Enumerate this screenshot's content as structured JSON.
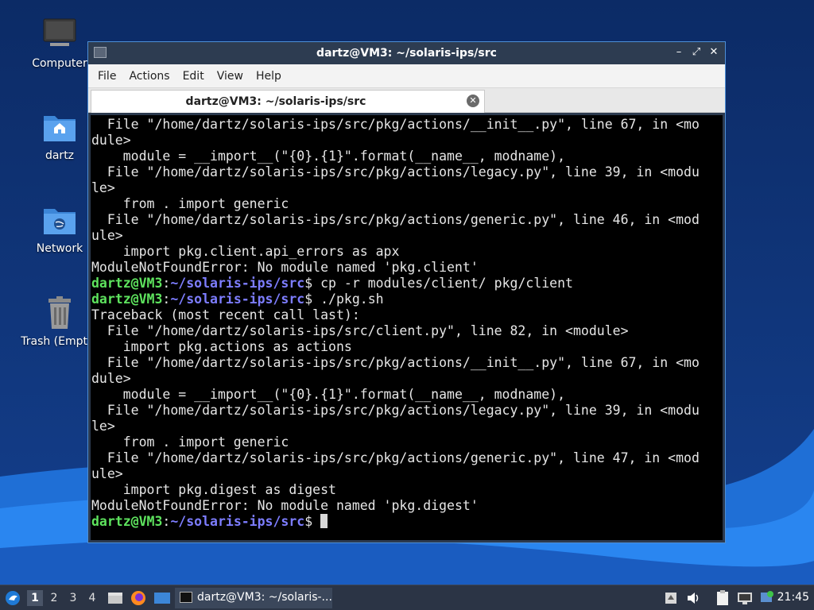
{
  "desktop": {
    "icons": [
      {
        "label": "Computer",
        "icon": "computer-icon"
      },
      {
        "label": "dartz",
        "icon": "home-folder-icon"
      },
      {
        "label": "Network",
        "icon": "network-folder-icon"
      },
      {
        "label": "Trash (Empty)",
        "icon": "trash-icon"
      }
    ]
  },
  "window": {
    "title": "dartz@VM3: ~/solaris-ips/src",
    "menu": [
      "File",
      "Actions",
      "Edit",
      "View",
      "Help"
    ],
    "tab": {
      "label": "dartz@VM3: ~/solaris-ips/src"
    },
    "terminal": {
      "prompt_user": "dartz@VM3",
      "prompt_path": "~/solaris-ips/src",
      "lines": [
        {
          "type": "out",
          "text": "  File \"/home/dartz/solaris-ips/src/pkg/actions/__init__.py\", line 67, in <mo"
        },
        {
          "type": "out",
          "text": "dule>"
        },
        {
          "type": "out",
          "text": "    module = __import__(\"{0}.{1}\".format(__name__, modname),"
        },
        {
          "type": "out",
          "text": "  File \"/home/dartz/solaris-ips/src/pkg/actions/legacy.py\", line 39, in <modu"
        },
        {
          "type": "out",
          "text": "le>"
        },
        {
          "type": "out",
          "text": "    from . import generic"
        },
        {
          "type": "out",
          "text": "  File \"/home/dartz/solaris-ips/src/pkg/actions/generic.py\", line 46, in <mod"
        },
        {
          "type": "out",
          "text": "ule>"
        },
        {
          "type": "out",
          "text": "    import pkg.client.api_errors as apx"
        },
        {
          "type": "out",
          "text": "ModuleNotFoundError: No module named 'pkg.client'"
        },
        {
          "type": "cmd",
          "text": " cp -r modules/client/ pkg/client"
        },
        {
          "type": "cmd",
          "text": " ./pkg.sh"
        },
        {
          "type": "out",
          "text": "Traceback (most recent call last):"
        },
        {
          "type": "out",
          "text": "  File \"/home/dartz/solaris-ips/src/client.py\", line 82, in <module>"
        },
        {
          "type": "out",
          "text": "    import pkg.actions as actions"
        },
        {
          "type": "out",
          "text": "  File \"/home/dartz/solaris-ips/src/pkg/actions/__init__.py\", line 67, in <mo"
        },
        {
          "type": "out",
          "text": "dule>"
        },
        {
          "type": "out",
          "text": "    module = __import__(\"{0}.{1}\".format(__name__, modname),"
        },
        {
          "type": "out",
          "text": "  File \"/home/dartz/solaris-ips/src/pkg/actions/legacy.py\", line 39, in <modu"
        },
        {
          "type": "out",
          "text": "le>"
        },
        {
          "type": "out",
          "text": "    from . import generic"
        },
        {
          "type": "out",
          "text": "  File \"/home/dartz/solaris-ips/src/pkg/actions/generic.py\", line 47, in <mod"
        },
        {
          "type": "out",
          "text": "ule>"
        },
        {
          "type": "out",
          "text": "    import pkg.digest as digest"
        },
        {
          "type": "out",
          "text": "ModuleNotFoundError: No module named 'pkg.digest'"
        },
        {
          "type": "cmd",
          "text": " ",
          "cursor": true
        }
      ]
    }
  },
  "taskbar": {
    "workspaces": [
      "1",
      "2",
      "3",
      "4"
    ],
    "active_workspace": "1",
    "task_label": "dartz@VM3: ~/solaris-...",
    "clock": "21:45"
  },
  "colors": {
    "prompt_user": "#5ee35e",
    "prompt_path": "#7d7dff",
    "window_border": "#4d8fd6"
  }
}
